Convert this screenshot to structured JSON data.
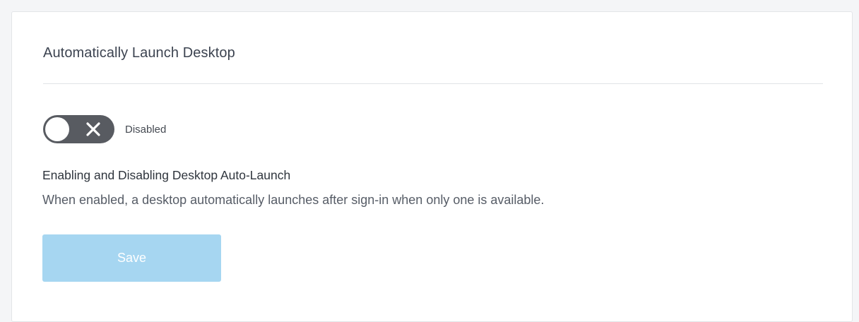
{
  "card": {
    "title": "Automatically Launch Desktop"
  },
  "toggle": {
    "state_label": "Disabled",
    "icon": "close-icon",
    "enabled": false
  },
  "description": {
    "heading": "Enabling and Disabling Desktop Auto-Launch",
    "body": "When enabled, a desktop automatically launches after sign-in when only one is available."
  },
  "actions": {
    "save_label": "Save",
    "save_disabled": true
  },
  "colors": {
    "toggle_bg": "#585b61",
    "save_button_bg": "#a6d6f1",
    "page_bg": "#f4f5f7"
  }
}
